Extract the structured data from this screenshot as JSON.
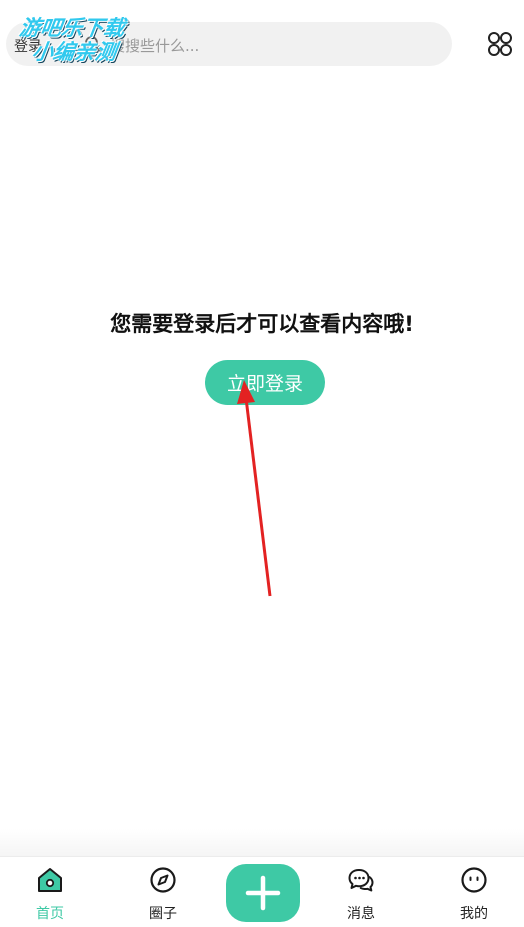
{
  "header": {
    "login_label": "登录",
    "search_placeholder": "搜搜些什么...",
    "watermark_line1": "游吧乐下载",
    "watermark_line2": "小编亲测"
  },
  "main": {
    "message": "您需要登录后才可以查看内容哦!",
    "login_button": "立即登录"
  },
  "bottom_nav": {
    "items": [
      {
        "label": "首页",
        "icon": "home-icon",
        "active": true
      },
      {
        "label": "圈子",
        "icon": "compass-icon",
        "active": false
      },
      {
        "label": "消息",
        "icon": "chat-icon",
        "active": false
      },
      {
        "label": "我的",
        "icon": "face-icon",
        "active": false
      }
    ],
    "add_icon": "plus-icon"
  },
  "colors": {
    "accent": "#3ec9a5",
    "annotation_arrow": "#e32222",
    "watermark": "#31c9ee"
  }
}
